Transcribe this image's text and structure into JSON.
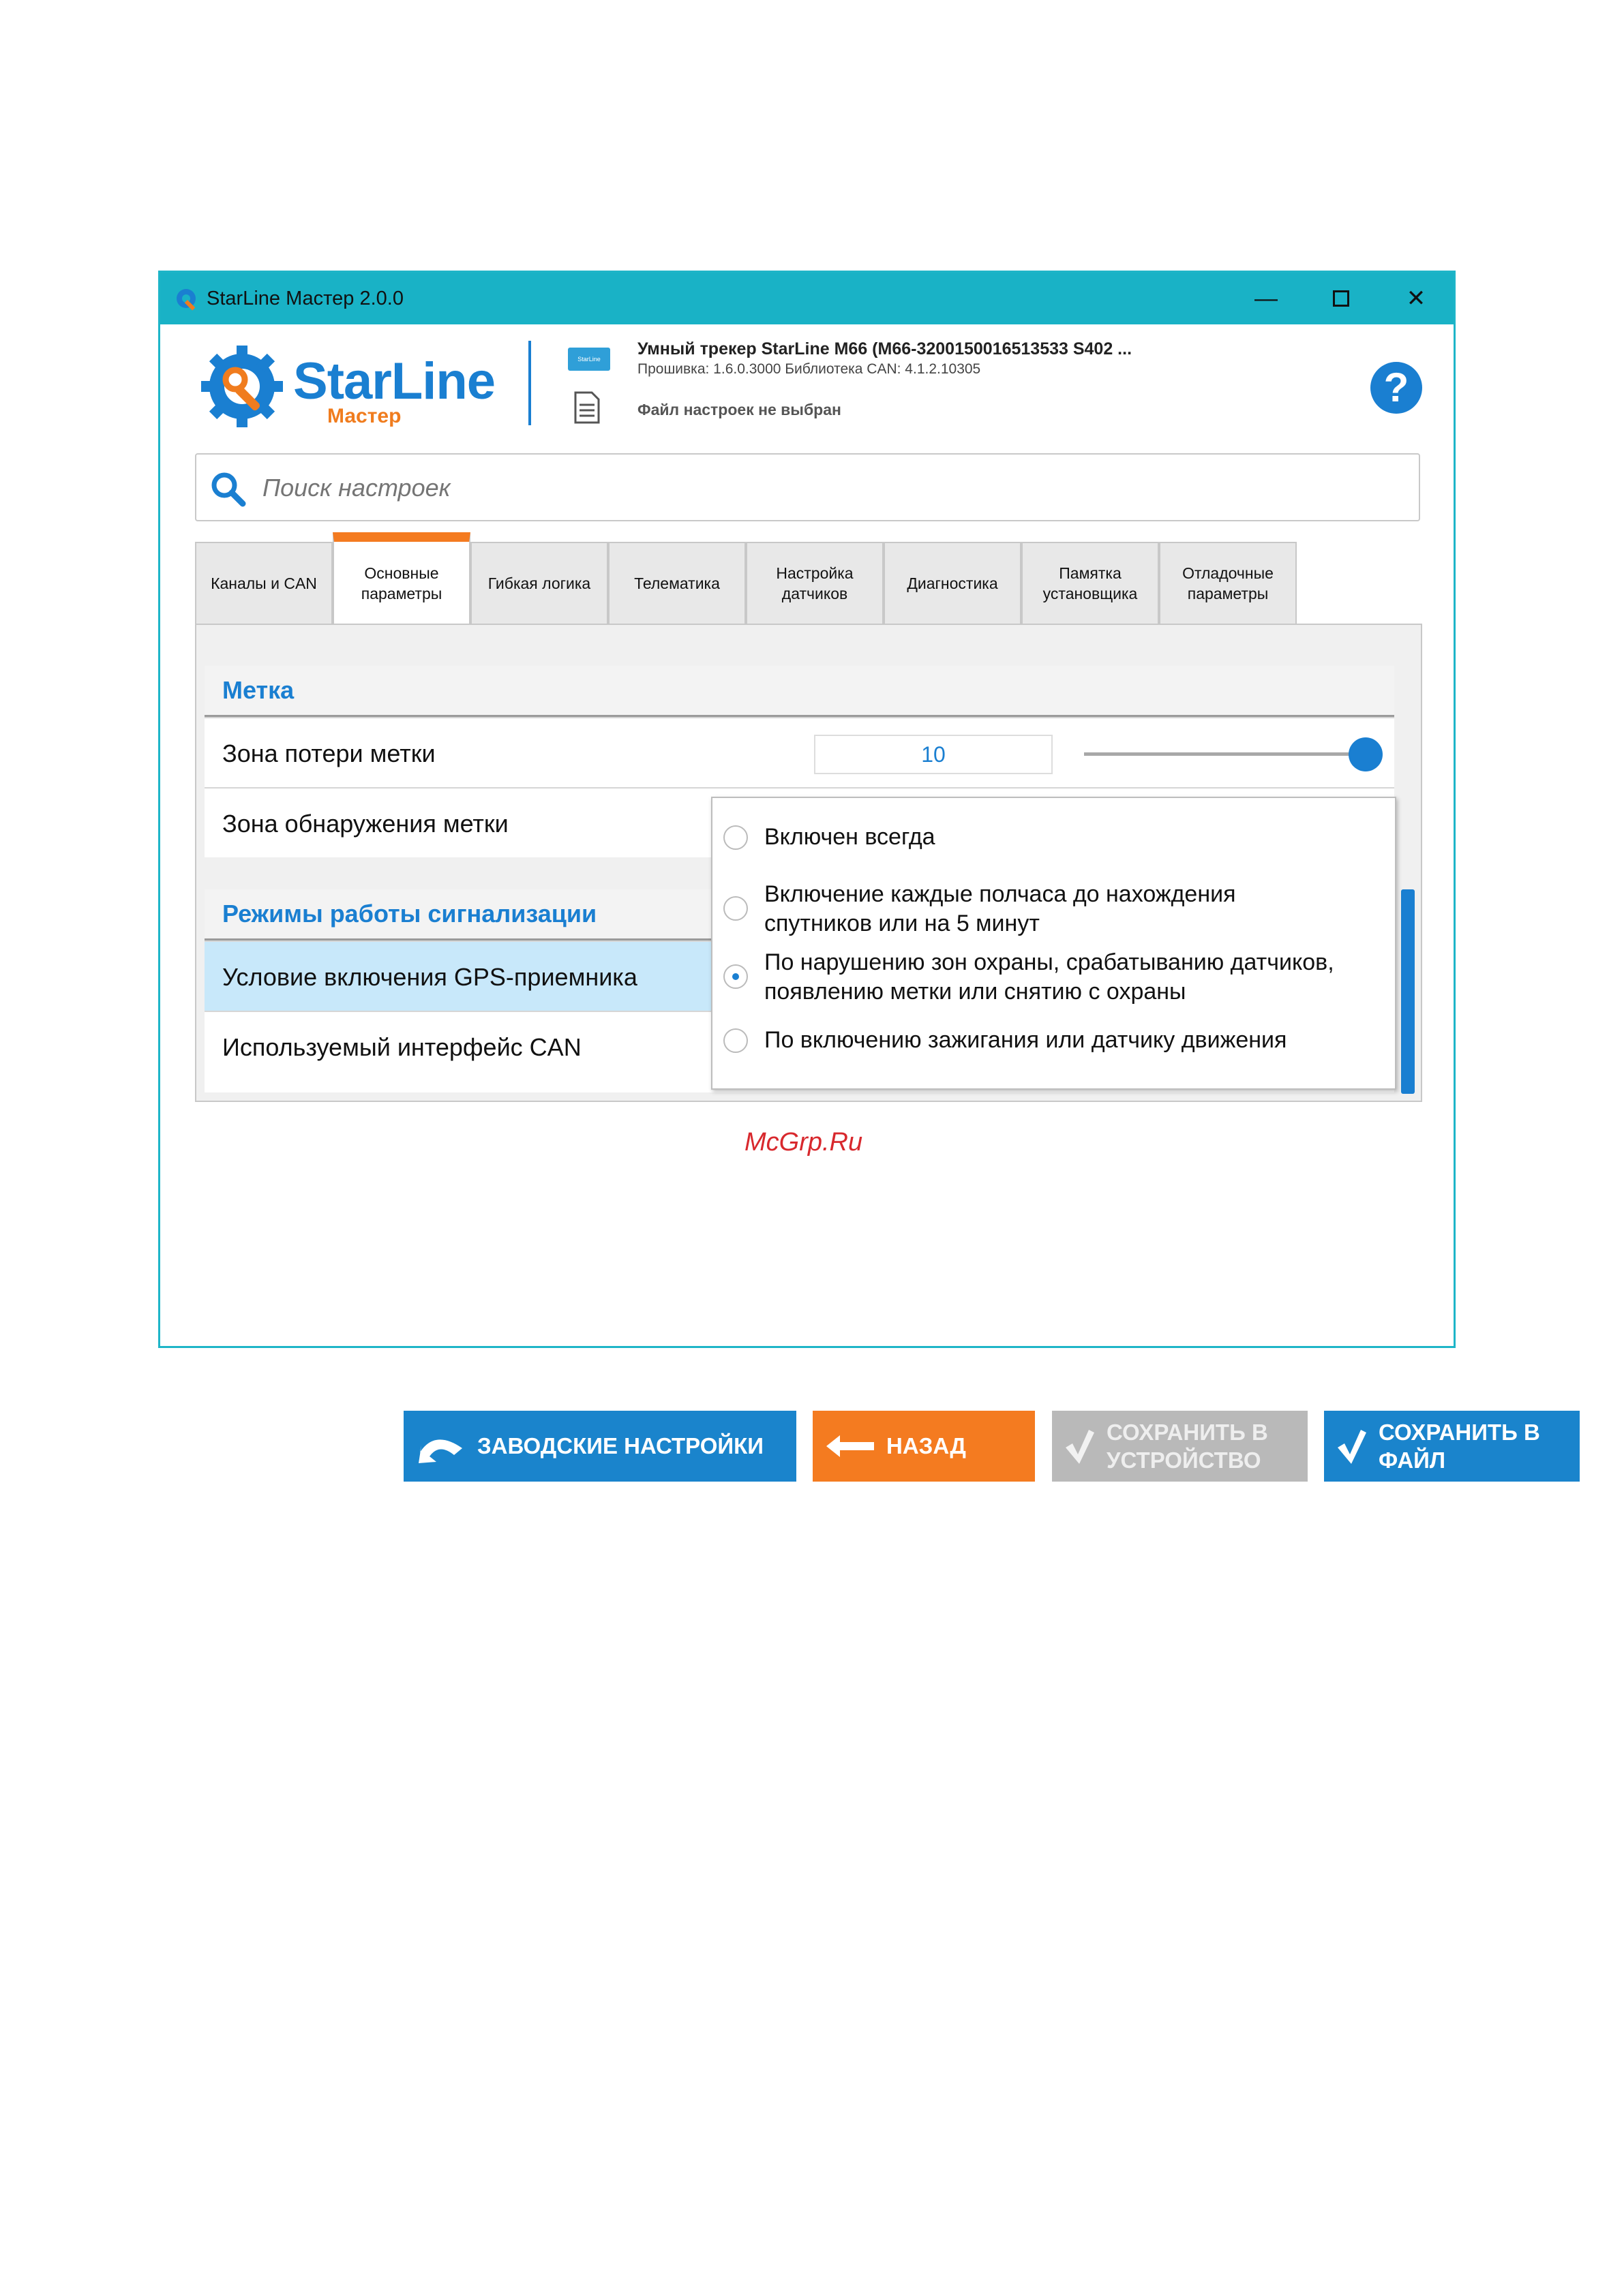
{
  "window": {
    "title": "StarLine Мастер 2.0.0",
    "controls": {
      "minimize": "—",
      "close": "✕"
    }
  },
  "header": {
    "logo_text": "StarLine",
    "logo_sub": "Мастер",
    "device_chip": "StarLine",
    "device_name": "Умный трекер StarLine M66 (M66-3200150016513533 S402 ...",
    "firmware": "Прошивка: 1.6.0.3000   Библиотека CAN: 4.1.2.10305",
    "file_status": "Файл настроек не выбран",
    "help": "?"
  },
  "search": {
    "placeholder": "Поиск настроек"
  },
  "tabs": [
    {
      "label": "Каналы и CAN"
    },
    {
      "label": "Основные параметры",
      "active": true
    },
    {
      "label": "Гибкая логика"
    },
    {
      "label": "Телематика"
    },
    {
      "label": "Настройка датчиков"
    },
    {
      "label": "Диагностика"
    },
    {
      "label": "Памятка установщика"
    },
    {
      "label": "Отладочные параметры"
    }
  ],
  "sections": [
    {
      "title": "Метка",
      "rows": [
        {
          "label": "Зона потери метки",
          "value": "10",
          "slider_fraction": 1.0
        },
        {
          "label": "Зона обнаружения метки"
        }
      ]
    },
    {
      "title": "Режимы работы сигнализации",
      "rows": [
        {
          "label": "Условие включения GPS-приемника",
          "selected": true
        },
        {
          "label": "Используемый интерфейс CAN"
        }
      ]
    }
  ],
  "dropdown": {
    "options": [
      {
        "label": "Включен всегда",
        "checked": false
      },
      {
        "label": "Включение каждые полчаса до нахождения\nспутников или на 5 минут",
        "checked": false
      },
      {
        "label": "По нарушению зон охраны, срабатыванию датчиков,\nпоявлению метки или снятию с охраны",
        "checked": true
      },
      {
        "label": "По включению зажигания или датчику движения",
        "checked": false
      }
    ]
  },
  "buttons": {
    "factory": "ЗАВОДСКИЕ НАСТРОЙКИ",
    "back": "НАЗАД",
    "save_device": "СОХРАНИТЬ В\nУСТРОЙСТВО",
    "save_file": "СОХРАНИТЬ В\nФАЙЛ"
  },
  "watermark": "McGrp.Ru",
  "colors": {
    "accent": "#1a7fd1",
    "titlebar": "#19b2c6",
    "orange": "#f47b20",
    "disabled": "#b9b9b9",
    "selected_row": "#c8e8fa"
  }
}
